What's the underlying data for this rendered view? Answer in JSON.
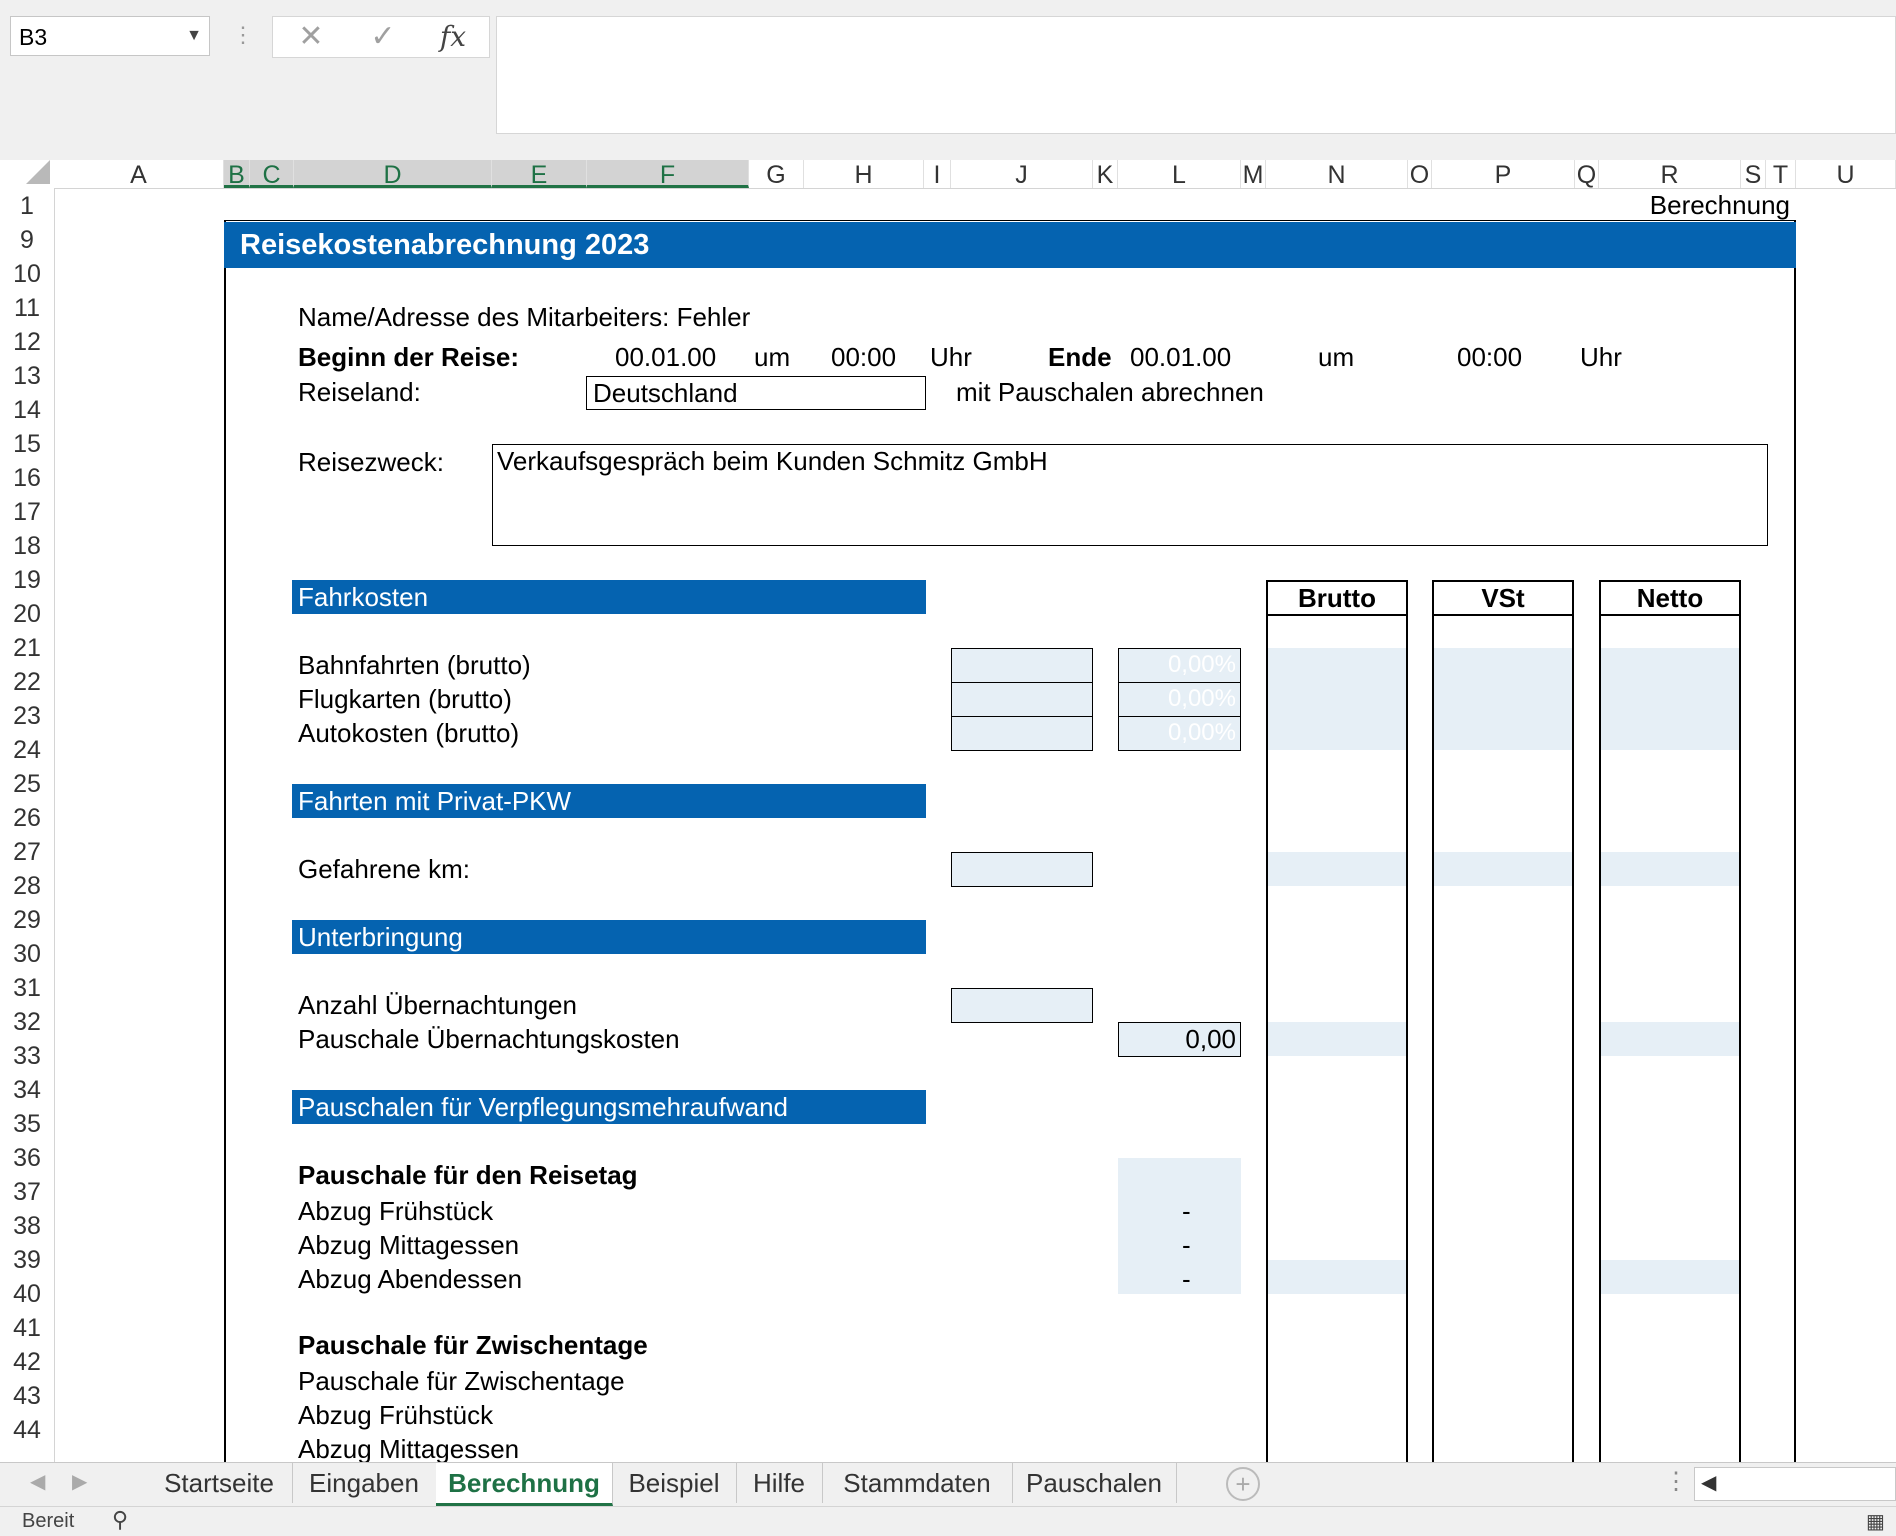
{
  "formula_bar": {
    "name_box": "B3",
    "formula": ""
  },
  "columns": [
    "A",
    "B",
    "C",
    "D",
    "E",
    "F",
    "G",
    "H",
    "I",
    "J",
    "K",
    "L",
    "M",
    "N",
    "O",
    "P",
    "Q",
    "R",
    "S",
    "T",
    "U"
  ],
  "rows": [
    "1",
    "9",
    "10",
    "11",
    "12",
    "13",
    "14",
    "15",
    "16",
    "17",
    "18",
    "19",
    "20",
    "21",
    "22",
    "23",
    "24",
    "25",
    "26",
    "27",
    "28",
    "29",
    "30",
    "31",
    "32",
    "33",
    "34",
    "35",
    "36",
    "37",
    "38",
    "39",
    "40",
    "41",
    "42",
    "43",
    "44"
  ],
  "sheet": {
    "corner_label": "Berechnung",
    "title": "Reisekostenabrechnung 2023",
    "employee_label": "Name/Adresse des Mitarbeiters: Fehler",
    "begin_label": "Beginn der Reise:",
    "begin_date": "00.01.00",
    "um1": "um",
    "begin_time": "00:00",
    "uhr1": "Uhr",
    "end_label": "Ende",
    "end_date": "00.01.00",
    "um2": "um",
    "end_time": "00:00",
    "uhr2": "Uhr",
    "country_label": "Reiseland:",
    "country_value": "Deutschland",
    "country_note": "mit Pauschalen abrechnen",
    "purpose_label": "Reisezweck:",
    "purpose_value": "Verkaufsgespräch beim Kunden Schmitz GmbH",
    "col_brutto": "Brutto",
    "col_vst": "VSt",
    "col_netto": "Netto",
    "sec_fahrkosten": "Fahrkosten",
    "bahn": "Bahnfahrten (brutto)",
    "flug": "Flugkarten (brutto)",
    "auto": "Autokosten (brutto)",
    "pct1": "0,00%",
    "pct2": "0,00%",
    "pct3": "0,00%",
    "sec_pkw": "Fahrten mit Privat-PKW",
    "km": "Gefahrene km:",
    "sec_unterbringung": "Unterbringung",
    "nights": "Anzahl Übernachtungen",
    "night_flat": "Pauschale Übernachtungskosten",
    "night_flat_value": "0,00",
    "sec_verpflegung": "Pauschalen für Verpflegungsmehraufwand",
    "reisetag_head": "Pauschale für den Reisetag",
    "abzug_fruehstueck": "Abzug Frühstück",
    "abzug_mittag": "Abzug Mittagessen",
    "abzug_abend": "Abzug Abendessen",
    "dash1": "-",
    "dash2": "-",
    "dash3": "-",
    "zwischentage_head": "Pauschale für  Zwischentage",
    "zwischentage": "Pauschale für Zwischentage",
    "abzug_fruehstueck2": "Abzug Frühstück",
    "abzug_mittag2": "Abzug Mittagessen"
  },
  "tabs": [
    "Startseite",
    "Eingaben",
    "Berechnung",
    "Beispiel",
    "Hilfe",
    "Stammdaten",
    "Pauschalen"
  ],
  "active_tab": "Berechnung",
  "status": "Bereit"
}
